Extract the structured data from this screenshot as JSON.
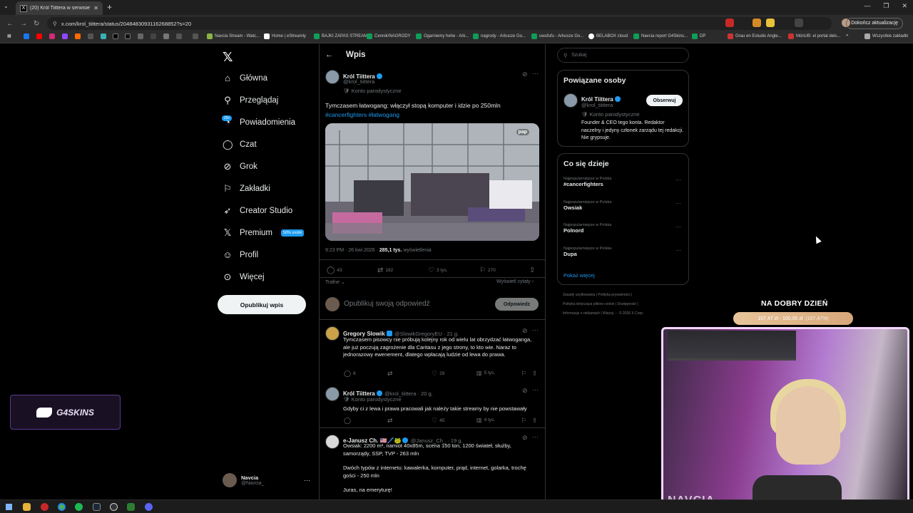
{
  "browser": {
    "tab_title": "(20) Król Tiittera w serwisie X",
    "url": "x.com/krol_tiittera/status/2048483093116268852?s=20",
    "update_label": "Dokończ aktualizację",
    "bookmarks": [
      "Navcia Stream - Watc...",
      "Home | eStreamly",
      "BAJKI ZAPAS STREAM",
      "Cennik/NAGRODY",
      "Ogarniemy hehe - Ark...",
      "nagrody - Arkusze Go...",
      "uwufufu - Arkusze Go...",
      "BELABOX cloud",
      "Navcia report G4Skins...",
      "DP",
      "Grau en Estudis Angle...",
      "MónUB: el portal dels...",
      "Wszystkie zakładki"
    ]
  },
  "nav": {
    "items": [
      {
        "label": "Główna",
        "icon": "home-icon"
      },
      {
        "label": "Przeglądaj",
        "icon": "search-icon"
      },
      {
        "label": "Powiadomienia",
        "icon": "bell-icon"
      },
      {
        "label": "Czat",
        "icon": "chat-icon"
      },
      {
        "label": "Grok",
        "icon": "grok-icon"
      },
      {
        "label": "Zakładki",
        "icon": "bookmark-icon"
      },
      {
        "label": "Creator Studio",
        "icon": "rocket-icon"
      },
      {
        "label": "Premium",
        "icon": "x-logo-icon"
      },
      {
        "label": "Profil",
        "icon": "person-icon"
      },
      {
        "label": "Więcej",
        "icon": "more-icon"
      }
    ],
    "notif_badge": "20+",
    "premium_promo": "50% zniżki",
    "post_button": "Opublikuj wpis",
    "me_name": "Navcia",
    "me_handle": "@Navcia_"
  },
  "post": {
    "header": "Wpis",
    "author": "Król Tiittera",
    "handle": "@krol_tiittera",
    "label": "Konto parodystyczne",
    "text": "Tymczasem łatwogang: włączył stopą komputer i idzie po 250mln",
    "hashtags": "#cancerfighters #łatwogang",
    "media_watermark": "pap",
    "time": "9:23 PM · 26 kwi 2026 · ",
    "views": "285,1 tys.",
    "views_label": " wyświetlenia",
    "replies": "43",
    "reposts": "182",
    "likes": "3 tys.",
    "bookmarks": "270",
    "sort": "Trafne",
    "quotes": "Wyświetl cytaty",
    "compose_placeholder": "Opublikuj swoją odpowiedź",
    "reply_button": "Odpowiedz"
  },
  "replies": [
    {
      "author": "Gregory Slowik",
      "handle": "@SlowikGregoryEU · 21 g.",
      "text": "Tymczasem pisowcy nie próbują kolejny rok od wielu lat obrzydzać łatwoganga, ale już poczują zagrożenie dla Caritasu z jego strony, to kto wie. Naraz to jednorazowy ewenement, dlatego wpłacają ludzie od lewa do prawa.",
      "replies": "6",
      "reposts": "",
      "likes": "29",
      "views": "5 tys."
    },
    {
      "author": "Król Tiittera",
      "handle": "@krol_tiittera · 20 g.",
      "label": "Konto parodystyczne",
      "text": "Gdyby ci z lewa i prawa pracowali jak należy takie streamy by nie powstawały",
      "replies": "",
      "reposts": "",
      "likes": "45",
      "views": "4 tys."
    },
    {
      "author": "e-Janusz Ch. 🇺🇸🖊️🐸",
      "handle": "@Janusz_Ch_ · 19 g.",
      "text1": "Owsiak: 2200 m², namiot 40x85m, scena 150 ton, 1200 świateł, służby, samorządy, SSP, TVP - 263 mln",
      "text2": "Dwóch typów z internetu: kawalerka, komputer, prąd, internet, golarka, trochę gości - 250 mln",
      "text3": "Juras, na emeryturę!"
    }
  ],
  "search_placeholder": "Szukaj",
  "related": {
    "title": "Powiązane osoby",
    "name": "Król Tiittera",
    "handle": "@krol_tiittera",
    "label": "Konto parodystyczne",
    "bio": "Founder & CEO tego konta. Redaktor naczelny i jedyny członek zarządu tej redakcji. Nie grypsuje.",
    "follow": "Obserwuj"
  },
  "trends": {
    "title": "Co się dzieje",
    "items": [
      {
        "cat": "Najpopularniejsze w Polska",
        "name": "#cancerfighters"
      },
      {
        "cat": "Najpopularniejsze w Polska",
        "name": "Owsiak"
      },
      {
        "cat": "Najpopularniejsze w Polska",
        "name": "Polnord"
      },
      {
        "cat": "Najpopularniejsze w Polska",
        "name": "Dupa"
      }
    ],
    "more": "Pokaż więcej"
  },
  "footer": {
    "l1": "Zasady użytkowania  |  Polityka prywatności  |",
    "l2": "Polityka dotycząca plików cookie  |  Dostępność  |",
    "l3": "Informacje o reklamach  |  Więcej ···  © 2026 X Corp."
  },
  "overlay": {
    "donate_title": "NA DOBRY DZIEŃ",
    "donate_amount": "107,47 zł  -  100,00 zł",
    "donate_pct": "(107,47%)",
    "g4_label": "G4SKINS",
    "cam_label": "NAVCIA"
  },
  "colors": {
    "accent": "#1d9bf0",
    "bg": "#000000",
    "border": "#2f3336",
    "muted": "#71767b"
  }
}
